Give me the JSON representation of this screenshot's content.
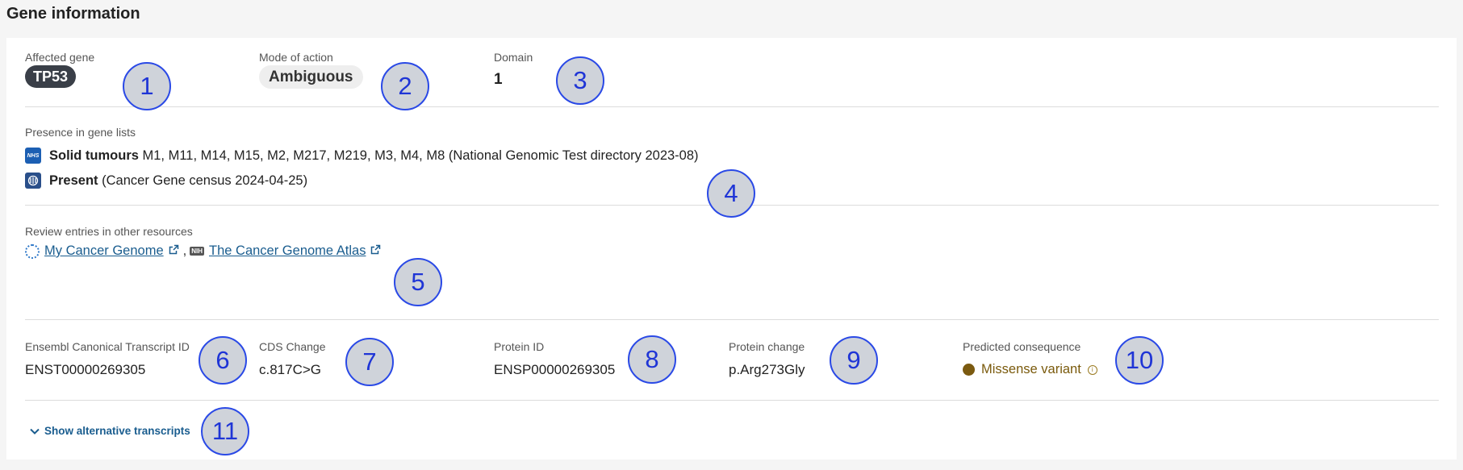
{
  "page": {
    "title": "Gene information"
  },
  "summary": {
    "affected_gene_label": "Affected gene",
    "affected_gene": "TP53",
    "mode_of_action_label": "Mode of action",
    "mode_of_action": "Ambiguous",
    "domain_label": "Domain",
    "domain": "1"
  },
  "gene_lists": {
    "label": "Presence in gene lists",
    "items": [
      {
        "icon": "nhs-icon",
        "title": "Solid tumours",
        "detail": "M1, M11, M14, M15, M2, M217, M219, M3, M4, M8 (National Genomic Test directory 2023-08)"
      },
      {
        "icon": "cancer-gene-census-icon",
        "title": "Present",
        "detail": "(Cancer Gene census 2024-04-25)"
      }
    ]
  },
  "resources": {
    "label": "Review entries in other resources",
    "links": [
      {
        "icon": "my-cancer-genome-icon",
        "text": "My Cancer Genome"
      },
      {
        "icon": "nih-icon",
        "icon_text": "NIH",
        "text": "The Cancer Genome Atlas"
      }
    ],
    "separator": ","
  },
  "transcript": {
    "ensembl_label": "Ensembl Canonical Transcript ID",
    "ensembl_value": "ENST00000269305",
    "cds_label": "CDS Change",
    "cds_value": "c.817C>G",
    "protein_id_label": "Protein ID",
    "protein_id_value": "ENSP00000269305",
    "protein_change_label": "Protein change",
    "protein_change_value": "p.Arg273Gly",
    "consequence_label": "Predicted consequence",
    "consequence_value": "Missense variant",
    "consequence_color": "#7b5a10"
  },
  "footer": {
    "show_alt_label": "Show alternative transcripts"
  },
  "markers": [
    "1",
    "2",
    "3",
    "4",
    "5",
    "6",
    "7",
    "8",
    "9",
    "10",
    "11"
  ],
  "colors": {
    "link": "#1a5d8f",
    "marker_border": "#2a49e6",
    "marker_fill": "#cfd3da",
    "gene_pill": "#3a3f48"
  }
}
